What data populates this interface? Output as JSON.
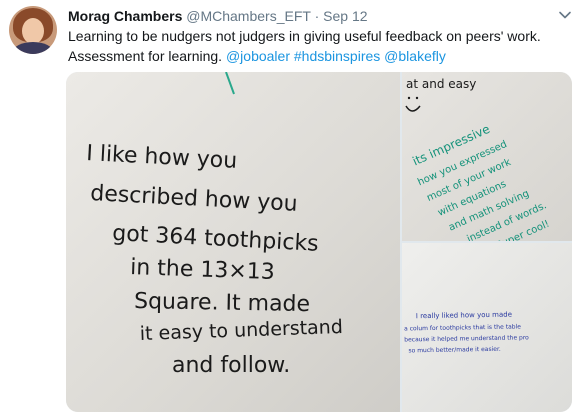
{
  "tweet": {
    "author_name": "Morag Chambers",
    "author_handle": "@MChambers_EFT",
    "separator": "·",
    "date": "Sep 12",
    "text_line1": "Learning to be nudgers not judgers in giving useful feedback on peers' work.",
    "text_line2_prefix": "Assessment for learning. ",
    "mention1": "@joboaler",
    "hashtag": "#hdsbinspires",
    "mention2": "@blakefly"
  },
  "photos": {
    "main_lines": [
      "I like how you",
      "described how you",
      "got 364 toothpicks",
      "in the 13×13",
      "Square. It made",
      "it easy to understand",
      "and follow."
    ],
    "top_right_top": "at and easy",
    "top_right_lines": [
      "its impressive",
      "how you expressed",
      "most of your work",
      "with equations",
      "and math solving",
      "instead of words.",
      "Super cool!"
    ],
    "bottom_right_lines": [
      "I really liked how you made",
      "a colum for toothpicks that is the table",
      "because it helped me understand the pro",
      "so much better/made it easier."
    ]
  },
  "colors": {
    "marker_black": "#1a1a1a",
    "marker_teal": "#14927a",
    "marker_blue": "#2a3aa0",
    "link": "#1b95e0"
  },
  "icons": {
    "menu": "chevron-down-icon"
  }
}
